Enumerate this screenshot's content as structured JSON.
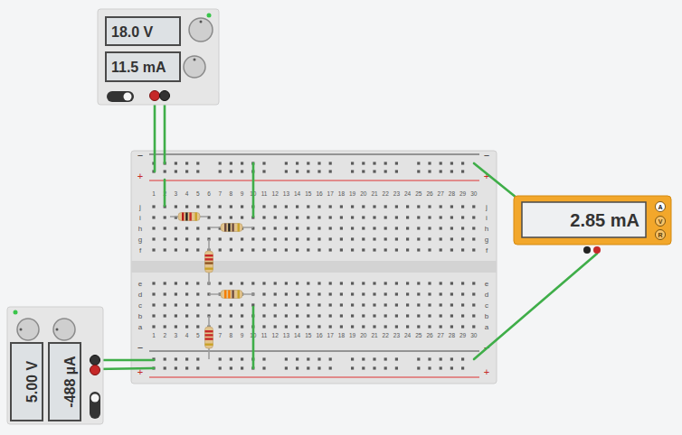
{
  "power_supply_top": {
    "voltage": "18.0 V",
    "current": "11.5 mA",
    "on": true
  },
  "power_supply_bottom": {
    "voltage": "5.00 V",
    "current": "-488 µA",
    "on": true
  },
  "multimeter": {
    "reading": "2.85 mA",
    "modes": [
      {
        "label": "A",
        "selected": true
      },
      {
        "label": "V",
        "selected": false
      },
      {
        "label": "R",
        "selected": false
      }
    ]
  },
  "breadboard": {
    "columns": [
      "1",
      "2",
      "3",
      "4",
      "5",
      "6",
      "7",
      "8",
      "9",
      "10",
      "11",
      "12",
      "13",
      "14",
      "15",
      "16",
      "17",
      "18",
      "19",
      "20",
      "21",
      "22",
      "23",
      "24",
      "25",
      "26",
      "27",
      "28",
      "29",
      "30"
    ],
    "upper_rows": [
      "j",
      "i",
      "h",
      "g",
      "f"
    ],
    "lower_rows": [
      "e",
      "d",
      "c",
      "b",
      "a"
    ],
    "rail_minus": "−",
    "rail_plus": "+"
  },
  "resistors": [
    {
      "bands": [
        "#b71c1c",
        "#212121",
        "#c62828",
        "#c9a227"
      ]
    },
    {
      "bands": [
        "#6d4c41",
        "#212121",
        "#6d4c41",
        "#c9a227"
      ]
    },
    {
      "bands": [
        "#c62828",
        "#c62828",
        "#8d5524",
        "#c9a227"
      ]
    },
    {
      "bands": [
        "#f57c00",
        "#f57c00",
        "#6d4c41",
        "#c9a227"
      ]
    },
    {
      "bands": [
        "#c62828",
        "#c62828",
        "#c62828",
        "#c9a227"
      ]
    }
  ]
}
